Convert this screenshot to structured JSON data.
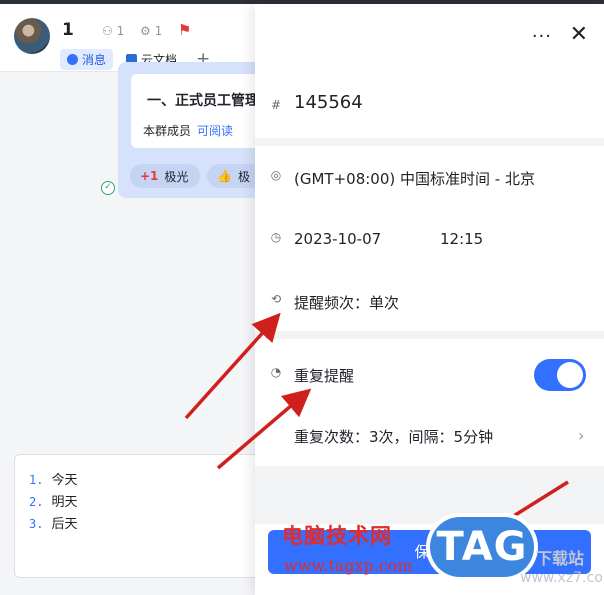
{
  "chat": {
    "name": "1",
    "member_count": "1",
    "bot_count": "1",
    "tabs": [
      {
        "label": "消息",
        "active": true
      },
      {
        "label": "云文档",
        "active": false
      }
    ],
    "add_tab": "+"
  },
  "message": {
    "title": "一、正式员工管理",
    "members_label": "本群成员",
    "read_link": "可阅读",
    "reactions": [
      {
        "icon": "+1",
        "label": "极光"
      },
      {
        "icon": "👍",
        "label": "极"
      }
    ]
  },
  "composer": {
    "items": [
      {
        "num": "1.",
        "text": "今天"
      },
      {
        "num": "2.",
        "text": "明天"
      },
      {
        "num": "3.",
        "text": "后天"
      }
    ]
  },
  "panel": {
    "more": "···",
    "close": "✕",
    "id_value": "145564",
    "timezone": "(GMT+08:00) 中国标准时间 - 北京",
    "date": "2023-10-07",
    "time": "12:15",
    "frequency": "提醒频次：单次",
    "repeat_label": "重复提醒",
    "repeat_enabled": true,
    "repeat_detail": "重复次数：3次，间隔：5分钟",
    "save_label": "保存"
  },
  "watermark": {
    "site_cn": "电脑技术网",
    "site_url": "www.tagxp.com",
    "badge": "TAG",
    "xz_cn": "下载站",
    "xz_url": "www.xz7.com"
  },
  "colors": {
    "accent": "#3370ff",
    "annotation_arrow": "#d0201e",
    "watermark_red": "#e32b2b"
  }
}
